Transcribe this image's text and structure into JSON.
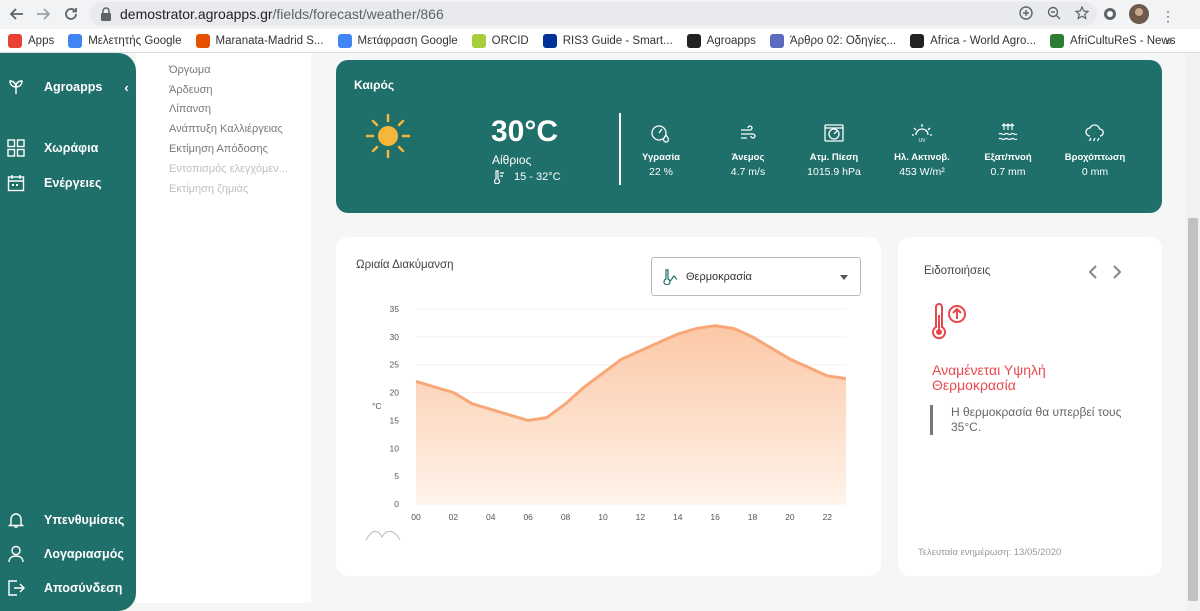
{
  "browser": {
    "url_host": "demostrator.agroapps.gr",
    "url_path": "/fields/forecast/weather/866",
    "bookmarks": [
      {
        "label": "Apps",
        "color": "#ea4335"
      },
      {
        "label": "Μελετητής Google",
        "color": "#4285f4"
      },
      {
        "label": "Maranata-Madrid S...",
        "color": "#e65100"
      },
      {
        "label": "Μετάφραση Google",
        "color": "#4285f4"
      },
      {
        "label": "ORCID",
        "color": "#a6ce39"
      },
      {
        "label": "RIS3 Guide - Smart...",
        "color": "#003399"
      },
      {
        "label": "Agroapps",
        "color": "#222222"
      },
      {
        "label": "Άρθρο 02: Οδηγίες...",
        "color": "#5c6bc0"
      },
      {
        "label": "Africa - World Agro...",
        "color": "#222222"
      },
      {
        "label": "AfriCultuReS - News",
        "color": "#2e7d32"
      }
    ]
  },
  "sidebar": {
    "brand": "Agroapps",
    "items": [
      {
        "label": "Χωράφια"
      },
      {
        "label": "Ενέργειες"
      }
    ],
    "bottom": [
      {
        "label": "Υπενθυμίσεις"
      },
      {
        "label": "Λογαριασμός"
      },
      {
        "label": "Αποσύνδεση"
      }
    ]
  },
  "submenu": [
    {
      "label": "Όργωμα",
      "disabled": false
    },
    {
      "label": "Άρδευση",
      "disabled": false
    },
    {
      "label": "Λίπανση",
      "disabled": false
    },
    {
      "label": "Ανάπτυξη Καλλιέργειας",
      "disabled": false
    },
    {
      "label": "Εκτίμηση Απόδοσης",
      "disabled": false
    },
    {
      "label": "Εντοπισμός ελεγχόμεν...",
      "disabled": true
    },
    {
      "label": "Εκτίμηση ζημιάς",
      "disabled": true
    }
  ],
  "weather": {
    "title": "Καιρός",
    "temp": "30°C",
    "condition": "Αίθριος",
    "range": "15 - 32°C",
    "metrics": [
      {
        "label": "Υγρασία",
        "value": "22 %",
        "icon": "humidity-icon"
      },
      {
        "label": "Άνεμος",
        "value": "4.7 m/s",
        "icon": "wind-icon"
      },
      {
        "label": "Ατμ. Πίεση",
        "value": "1015.9 hPa",
        "icon": "pressure-icon"
      },
      {
        "label": "Ηλ. Ακτινοβ.",
        "value": "453 W/m²",
        "icon": "uv-icon"
      },
      {
        "label": "Εξατ/πνοή",
        "value": "0.7 mm",
        "icon": "evapotranspiration-icon"
      },
      {
        "label": "Βροχόπτωση",
        "value": "0 mm",
        "icon": "rain-icon"
      }
    ]
  },
  "hourly": {
    "title": "Ωριαία Διακύμανση",
    "selected": "Θερμοκρασία"
  },
  "chart_data": {
    "type": "area",
    "ylabel": "°C",
    "ylim": [
      0,
      35
    ],
    "yticks": [
      0,
      5,
      10,
      15,
      20,
      25,
      30,
      35
    ],
    "xticks": [
      "00",
      "02",
      "04",
      "06",
      "08",
      "10",
      "12",
      "14",
      "16",
      "18",
      "20",
      "22"
    ],
    "x": [
      0,
      1,
      2,
      3,
      4,
      5,
      6,
      7,
      8,
      9,
      10,
      11,
      12,
      13,
      14,
      15,
      16,
      17,
      18,
      19,
      20,
      21,
      22,
      23
    ],
    "values": [
      22,
      21,
      20,
      18,
      17,
      16,
      15,
      15.5,
      18,
      21,
      23.5,
      26,
      27.5,
      29,
      30.5,
      31.5,
      32,
      31.5,
      30,
      28,
      26,
      24.5,
      23,
      22.5
    ],
    "color": "#f8a878"
  },
  "notifications": {
    "title": "Ειδοποιήσεις",
    "alert_title": "Αναμένεται Υψηλή Θερμοκρασία",
    "alert_body": "Η θερμοκρασία θα υπερβεί τους 35°C.",
    "updated": "Τελευταία ενημέρωση: 13/05/2020"
  }
}
